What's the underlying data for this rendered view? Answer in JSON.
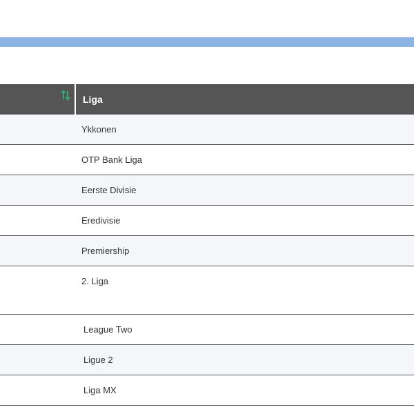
{
  "table": {
    "header": {
      "col2_label": "Liga"
    },
    "rows": [
      {
        "liga": "Ykkonen"
      },
      {
        "liga": "OTP Bank Liga"
      },
      {
        "liga": "Eerste Divisie"
      },
      {
        "liga": "Eredivisie"
      },
      {
        "liga": "Premiership"
      },
      {
        "liga": "2. Liga"
      },
      {
        "liga": "League Two"
      },
      {
        "liga": "Ligue 2"
      },
      {
        "liga": "Liga MX"
      }
    ]
  },
  "colors": {
    "topbar": "#8eb4e3",
    "header_bg": "#555555",
    "sort_icon": "#3aa876",
    "row_alt_bg": "#f4f6f9"
  },
  "icons": {
    "sort": "sort-arrows-icon"
  }
}
